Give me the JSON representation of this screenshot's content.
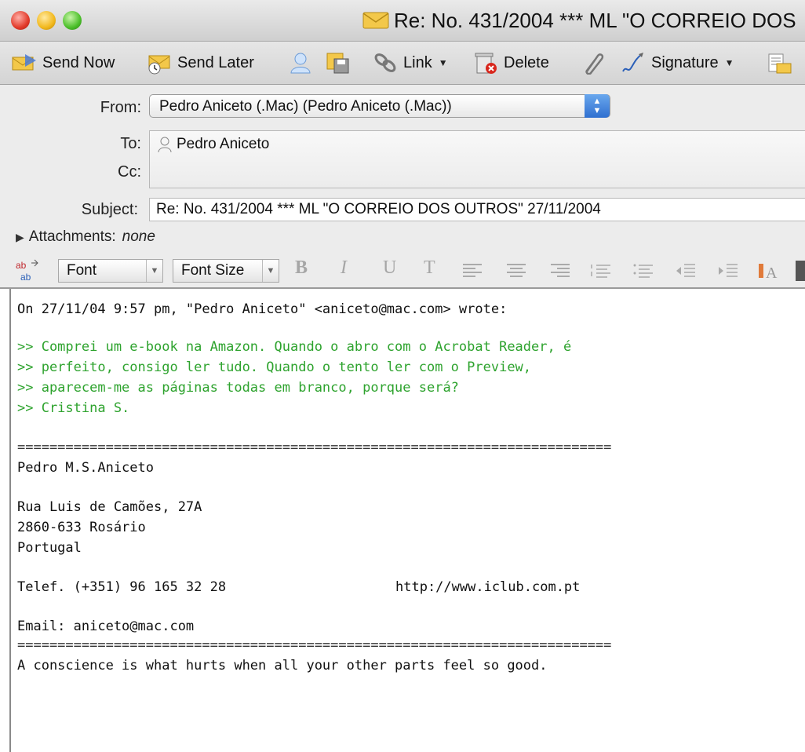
{
  "window": {
    "title": "Re: No. 431/2004 *** ML \"O CORREIO DOS"
  },
  "toolbar": {
    "send_now": "Send Now",
    "send_later": "Send Later",
    "link": "Link",
    "delete": "Delete",
    "signature": "Signature"
  },
  "headers": {
    "from_label": "From:",
    "from_value": "Pedro Aniceto (.Mac) (Pedro Aniceto (.Mac))",
    "to_label": "To:",
    "to_value": "Pedro Aniceto",
    "cc_label": "Cc:",
    "subject_label": "Subject:",
    "subject_value": "Re: No. 431/2004 *** ML \"O CORREIO DOS OUTROS\"  27/11/2004",
    "attachments_label": "Attachments:",
    "attachments_value": "none"
  },
  "format_bar": {
    "font": "Font",
    "font_size": "Font Size",
    "bold": "B",
    "italic": "I",
    "underline": "U",
    "text": "T"
  },
  "body": {
    "intro": "On 27/11/04 9:57 pm, \"Pedro Aniceto\" <aniceto@mac.com> wrote:",
    "quote1": ">> Comprei um e-book na Amazon. Quando o abro com o Acrobat Reader, é",
    "quote2": ">> perfeito, consigo ler tudo. Quando o tento ler com o Preview,",
    "quote3": ">> aparecem-me as páginas todas em branco, porque será?",
    "quote4": ">> Cristina S.",
    "separator": "==========================================================================",
    "sig_name": "Pedro M.S.Aniceto",
    "addr1": "Rua Luis de Camões, 27A",
    "addr2": "2860-633 Rosário",
    "addr3": "Portugal",
    "phone": "Telef. (+351) 96 165 32 28",
    "url": "http://www.iclub.com.pt",
    "email": "Email: aniceto@mac.com",
    "quote_line": "A conscience is what hurts when all your other parts feel so good."
  }
}
